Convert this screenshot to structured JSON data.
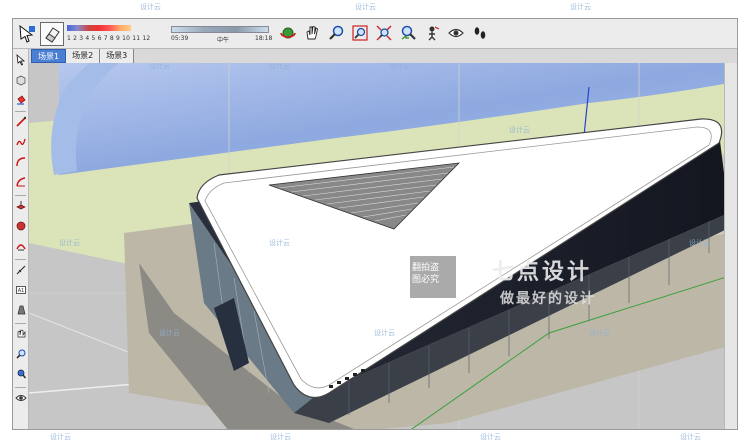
{
  "toolbar": {
    "shadow_months": "1 2 3 4 5 6 7 8 9 10 11 12",
    "time_start": "05:39",
    "time_noon": "中午",
    "time_end": "18:18"
  },
  "scene_tabs": [
    {
      "label": "场景1",
      "active": true
    },
    {
      "label": "场景2",
      "active": false
    },
    {
      "label": "场景3",
      "active": false
    }
  ],
  "nav_tools": [
    "orbit-icon",
    "pan-icon",
    "zoom-icon",
    "zoom-window-icon",
    "zoom-extents-icon",
    "previous-view-icon",
    "position-camera-icon",
    "look-around-icon",
    "walk-icon"
  ],
  "left_tools": [
    "select-icon",
    "make-component-icon",
    "paint-bucket-icon",
    "eraser-icon",
    "line-icon",
    "freehand-icon",
    "arc-icon",
    "circle-icon",
    "push-pull-icon",
    "follow-me-icon",
    "offset-icon",
    "move-icon",
    "rotate-icon",
    "scale-icon",
    "tape-measure-icon",
    "dimension-icon",
    "text-icon",
    "axes-icon",
    "section-plane-icon",
    "orbit-icon",
    "zoom-icon",
    "zoom-window-icon",
    "walk-icon",
    "look-around-icon"
  ],
  "watermark": {
    "repeat_text": "设计云",
    "box_line1": "翻拍盗",
    "box_line2": "图必究",
    "title": "七点设计",
    "subtitle": "做最好的设计"
  },
  "colors": {
    "sky": "#9fb9e6",
    "grass": "#d9e3b4",
    "ground": "#c8c8c8",
    "roof": "#ffffff",
    "glass": "#1d2230",
    "active_tab": "#4a7fd4"
  }
}
